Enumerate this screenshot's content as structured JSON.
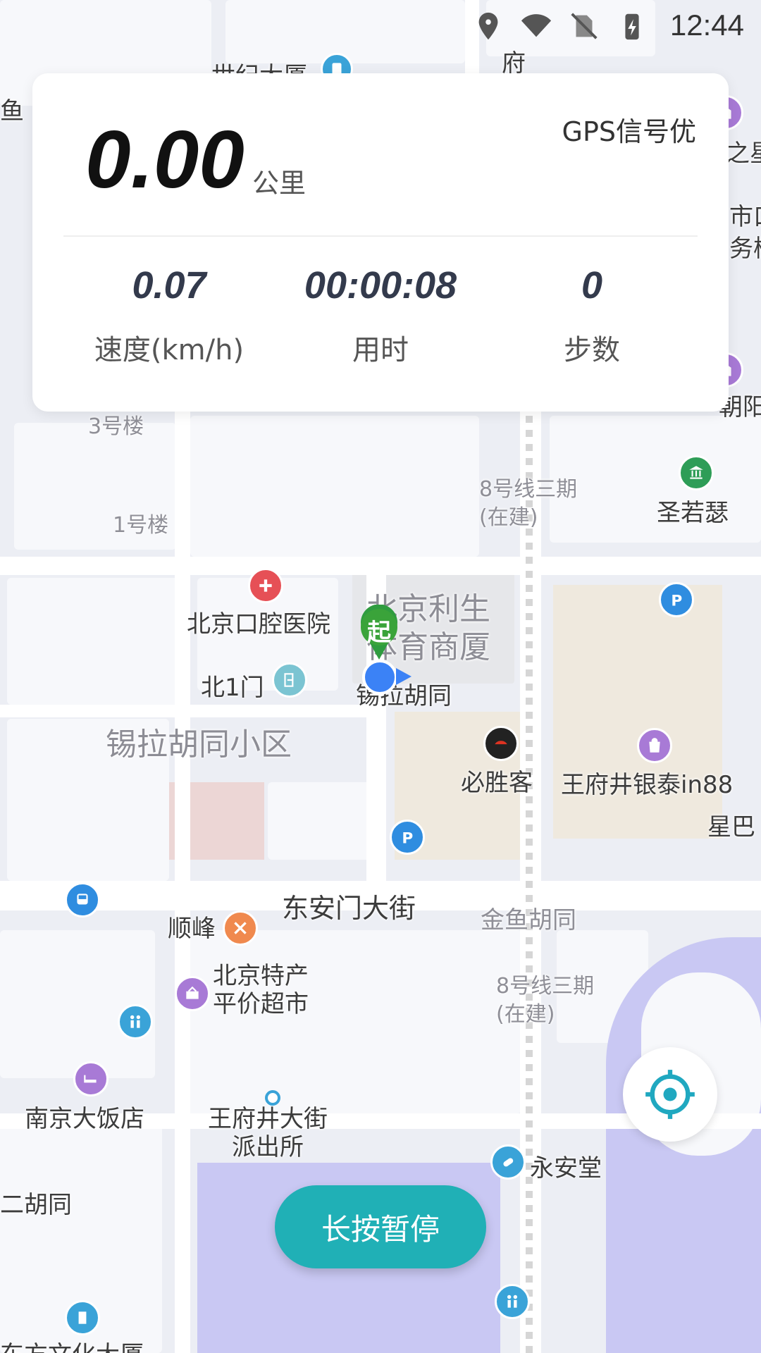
{
  "status_bar": {
    "time": "12:44"
  },
  "tracker": {
    "distance_value": "0.00",
    "distance_unit": "公里",
    "gps_status": "GPS信号优",
    "stats": [
      {
        "value": "0.07",
        "label": "速度(km/h)"
      },
      {
        "value": "00:00:08",
        "label": "用时"
      },
      {
        "value": "0",
        "label": "步数"
      }
    ]
  },
  "map": {
    "start_marker": "起",
    "labels": {
      "top_left_fragment": "鱼",
      "top_building": "世纪大厦",
      "right_top_fragment": "之星",
      "right_fragment_2": "市口",
      "right_fragment_3": "务楼",
      "right_fragment_4": "朝阳",
      "top_road_fragment": "府",
      "bldg3": "3号楼",
      "bldg1": "1号楼",
      "line8_top": "8号线三期(在建)",
      "shengruose": "圣若瑟",
      "dental": "北京口腔医院",
      "lisheng": "北京利生体育商厦",
      "north_gate": "北1门",
      "xila_hutong": "锡拉胡同",
      "xila_community": "锡拉胡同小区",
      "pizzahut": "必胜客",
      "in88": "王府井银泰in88",
      "starbucks_fragment": "星巴",
      "dongan_street": "东安门大街",
      "jinyu_hutong": "金鱼胡同",
      "shunfeng": "顺峰",
      "specialty_market": "北京特产平价超市",
      "line8_bottom": "8号线三期(在建)",
      "nanjing_hotel": "南京大饭店",
      "police": "王府井大街派出所",
      "yonganzhang": "永安堂",
      "hutong_fragment": "二胡同",
      "oriental_bldg": "东方文化大厦"
    }
  },
  "controls": {
    "pause_label": "长按暂停"
  },
  "colors": {
    "accent": "#20b0b6",
    "location": "#3b82f6",
    "start_marker": "#3aa33a"
  }
}
